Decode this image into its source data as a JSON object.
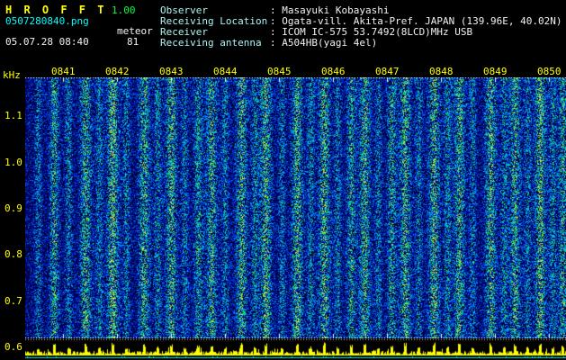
{
  "header": {
    "app_title": "H R O F F T",
    "version": "1.00",
    "filename": "0507280840.png",
    "mode_label": "meteor",
    "datetime": "05.07.28 08:40",
    "count": "81",
    "fields": [
      {
        "label": "Observer",
        "value": ": Masayuki Kobayashi"
      },
      {
        "label": "Receiving Location",
        "value": ": Ogata-vill. Akita-Pref. JAPAN (139.96E, 40.02N)"
      },
      {
        "label": "Receiver",
        "value": ": ICOM IC-575 53.7492(8LCD)MHz USB"
      },
      {
        "label": "Receiving antenna",
        "value": ": A504HB(yagi 4el)"
      }
    ]
  },
  "colors": {
    "title": "#ffff00",
    "version": "#00ff40",
    "filename": "#00ffff",
    "header_text": "#f2f2f2",
    "axis_text": "#ffff00",
    "trace": "#ffff00",
    "baseline": "#00e0e0",
    "spectrogram_background": "#000030"
  },
  "chart_data": {
    "type": "heatmap",
    "title": "Radio meteor echo spectrogram with signal-level strip",
    "x_axis": {
      "tick_labels": [
        "0841",
        "0842",
        "0843",
        "0844",
        "0845",
        "0846",
        "0847",
        "0848",
        "0849",
        "0850"
      ],
      "start": "08:40",
      "end": "08:50"
    },
    "y_axis": {
      "unit": "kHz",
      "tick_labels": [
        "1.1",
        "1.0",
        "0.9",
        "0.8",
        "0.7",
        "0.6"
      ],
      "range": [
        0.55,
        1.18
      ]
    },
    "noise_floor": 0.24,
    "seed": 20050728,
    "bands": [
      [
        14,
        4,
        0.45
      ],
      [
        32,
        5,
        0.75
      ],
      [
        48,
        4,
        0.5
      ],
      [
        67,
        6,
        0.8
      ],
      [
        82,
        4,
        0.5
      ],
      [
        97,
        6,
        1.0
      ],
      [
        112,
        4,
        0.5
      ],
      [
        132,
        6,
        0.8
      ],
      [
        147,
        4,
        0.55
      ],
      [
        162,
        6,
        0.85
      ],
      [
        177,
        4,
        0.5
      ],
      [
        192,
        5,
        0.65
      ],
      [
        207,
        6,
        0.8
      ],
      [
        222,
        4,
        0.5
      ],
      [
        240,
        6,
        0.85
      ],
      [
        255,
        4,
        0.55
      ],
      [
        267,
        6,
        0.9
      ],
      [
        285,
        4,
        0.5
      ],
      [
        302,
        6,
        0.85
      ],
      [
        317,
        4,
        0.55
      ],
      [
        332,
        6,
        0.9
      ],
      [
        347,
        4,
        0.5
      ],
      [
        362,
        5,
        0.7
      ],
      [
        377,
        6,
        0.8
      ],
      [
        392,
        4,
        0.5
      ],
      [
        407,
        5,
        0.7
      ],
      [
        422,
        6,
        0.85
      ],
      [
        437,
        4,
        0.5
      ],
      [
        454,
        6,
        0.9
      ],
      [
        469,
        4,
        0.55
      ],
      [
        482,
        6,
        0.8
      ],
      [
        497,
        4,
        0.5
      ],
      [
        517,
        6,
        0.85
      ],
      [
        532,
        4,
        0.55
      ],
      [
        544,
        6,
        0.8
      ],
      [
        558,
        4,
        0.5
      ],
      [
        572,
        6,
        0.9
      ],
      [
        586,
        4,
        0.55
      ],
      [
        597,
        5,
        0.7
      ]
    ],
    "level_strip": {
      "description": "signal level vs time trace at bottom",
      "trace_color": "#ffff00",
      "baseline_color": "#00e0e0"
    }
  }
}
